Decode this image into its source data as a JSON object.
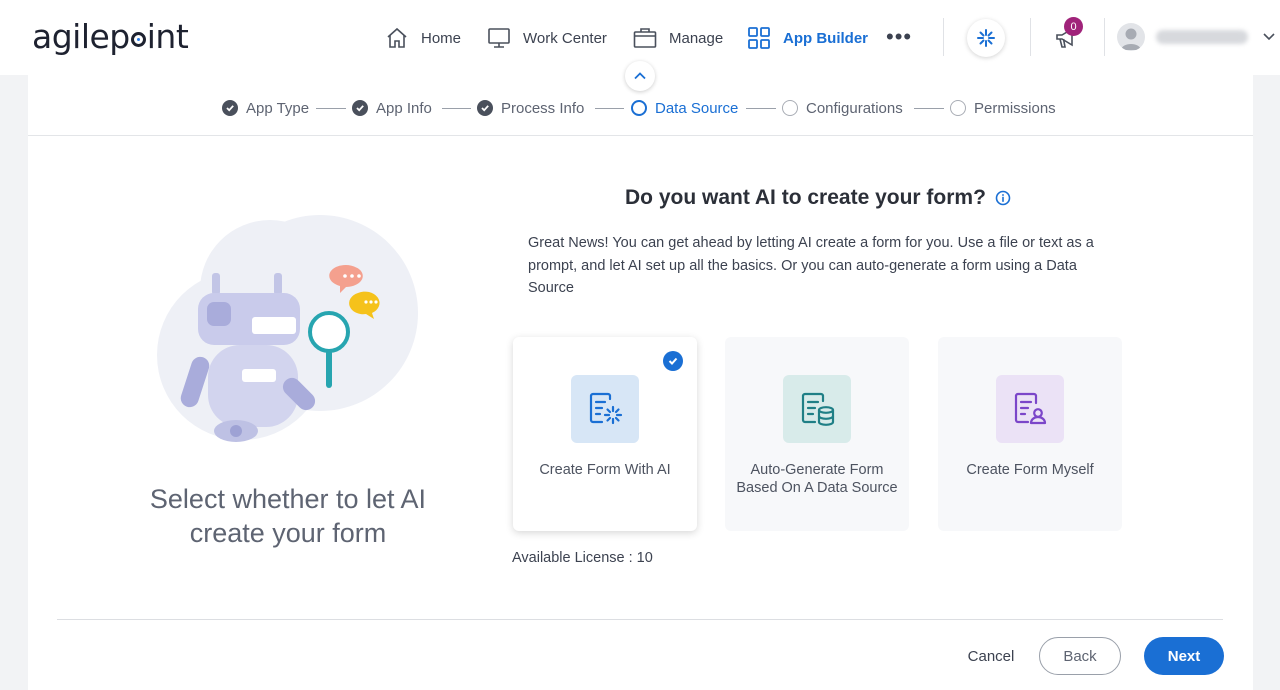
{
  "colors": {
    "accent": "#1a6fd4",
    "badge": "#a0237a"
  },
  "brand": {
    "logo_text_a": "agilep",
    "logo_text_b": "int"
  },
  "nav": {
    "items": [
      {
        "label": "Home",
        "icon": "home-icon"
      },
      {
        "label": "Work Center",
        "icon": "monitor-icon"
      },
      {
        "label": "Manage",
        "icon": "briefcase-icon"
      },
      {
        "label": "App Builder",
        "icon": "grid-icon",
        "active": true
      }
    ],
    "more": "•••",
    "notifications_count": "0"
  },
  "stepper": {
    "steps": [
      {
        "label": "App Type",
        "state": "done"
      },
      {
        "label": "App Info",
        "state": "done"
      },
      {
        "label": "Process Info",
        "state": "done"
      },
      {
        "label": "Data Source",
        "state": "current"
      },
      {
        "label": "Configurations",
        "state": "todo"
      },
      {
        "label": "Permissions",
        "state": "todo"
      }
    ]
  },
  "left": {
    "caption": "Select whether to let AI create your form"
  },
  "main": {
    "question": "Do you want AI to create your form?",
    "description": "Great News! You can get ahead by letting AI create a form for you. Use a file or text as a prompt, and let AI set up all the basics. Or you can auto-generate a form using a Data Source",
    "options": [
      {
        "label": "Create Form With AI",
        "icon": "ai-form-icon",
        "selected": true
      },
      {
        "label": "Auto-Generate Form Based On A Data Source",
        "icon": "database-form-icon",
        "selected": false
      },
      {
        "label": "Create Form Myself",
        "icon": "user-form-icon",
        "selected": false
      }
    ],
    "license": "Available License : 10"
  },
  "footer": {
    "cancel": "Cancel",
    "back": "Back",
    "next": "Next"
  }
}
